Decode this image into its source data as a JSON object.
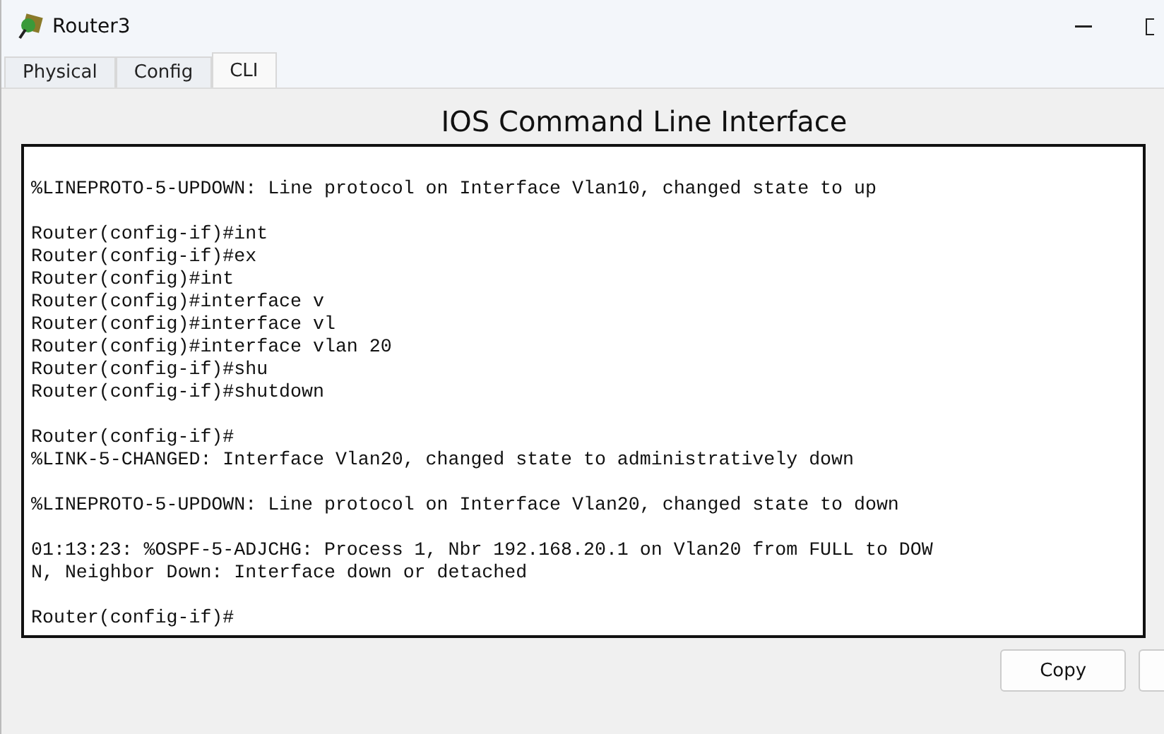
{
  "window": {
    "title": "Router3"
  },
  "tabs": [
    {
      "label": "Physical",
      "selected": false
    },
    {
      "label": "Config",
      "selected": false
    },
    {
      "label": "CLI",
      "selected": true
    }
  ],
  "heading": "IOS Command Line Interface",
  "terminal": {
    "blocks": [
      [
        "%LINEPROTO-5-UPDOWN: Line protocol on Interface Vlan10, changed state to up"
      ],
      [
        "Router(config-if)#int",
        "Router(config-if)#ex",
        "Router(config)#int",
        "Router(config)#interface v",
        "Router(config)#interface vl",
        "Router(config)#interface vlan 20",
        "Router(config-if)#shu",
        "Router(config-if)#shutdown"
      ],
      [
        "Router(config-if)#",
        "%LINK-5-CHANGED: Interface Vlan20, changed state to administratively down"
      ],
      [
        "%LINEPROTO-5-UPDOWN: Line protocol on Interface Vlan20, changed state to down"
      ],
      [
        "01:13:23: %OSPF-5-ADJCHG: Process 1, Nbr 192.168.20.1 on Vlan20 from FULL to DOW",
        "N, Neighbor Down: Interface down or detached"
      ],
      [
        "Router(config-if)#"
      ]
    ]
  },
  "buttons": [
    "Copy"
  ]
}
